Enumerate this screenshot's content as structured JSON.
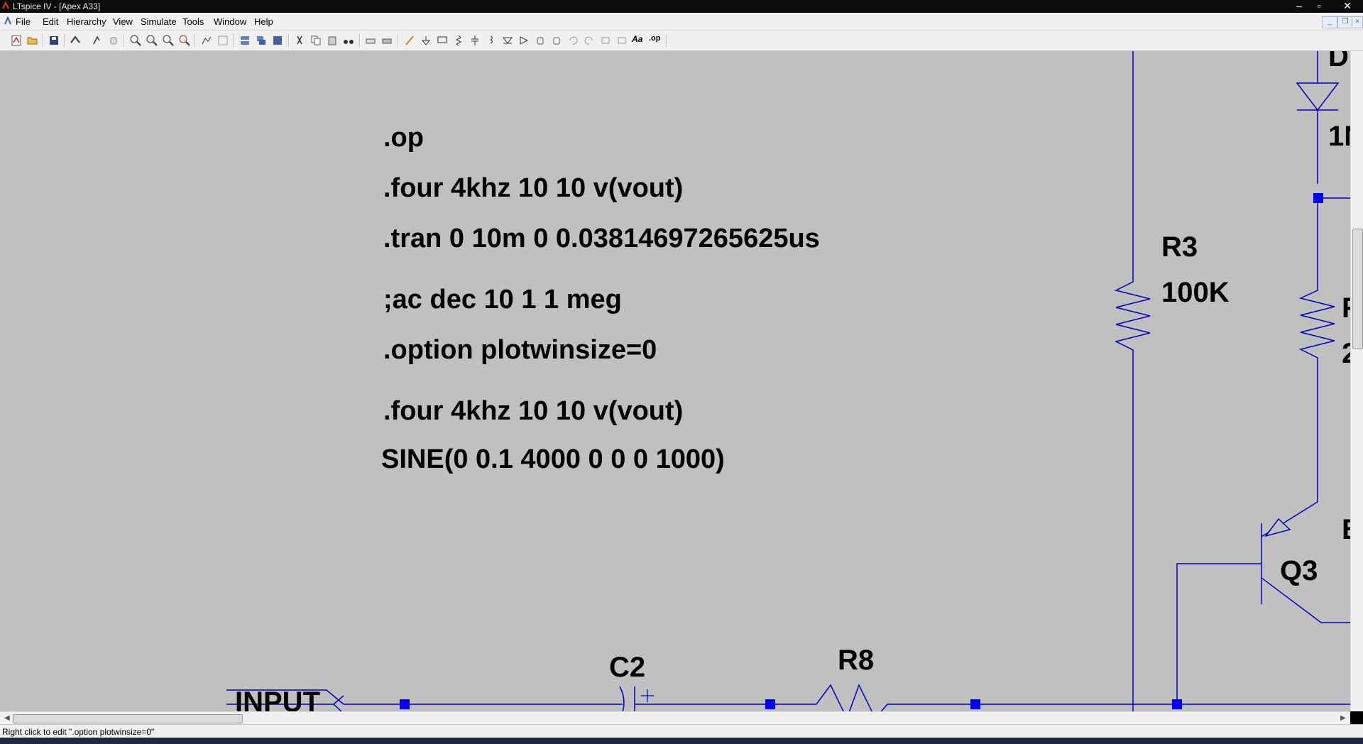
{
  "window": {
    "title": "LTspice IV - [Apex A33]"
  },
  "menu": [
    "File",
    "Edit",
    "Hierarchy",
    "View",
    "Simulate",
    "Tools",
    "Window",
    "Help"
  ],
  "directives": [
    ".op",
    ".four 4khz 10 10 v(vout)",
    ".tran 0 10m 0 0.03814697265625us",
    ";ac dec 10 1 1 meg",
    ".option plotwinsize=0",
    ".four 4khz 10 10 v(vout)",
    "SINE(0 0.1 4000 0 0 0 1000)"
  ],
  "components": {
    "r3_name": "R3",
    "r3_value": "100K",
    "q3_name": "Q3",
    "c2_name": "C2",
    "r8_name": "R8",
    "input_label": "INPUT",
    "d_name_partial": "D",
    "d_value_partial": "1N",
    "r_partial_name": "R",
    "r_partial_value": "2",
    "q_partial": "B"
  },
  "status": {
    "text": "Right click to edit \".option plotwinsize=0\""
  },
  "colors": {
    "canvas": "#c0c0c0",
    "wire": "#0000bb",
    "junction": "#0000ff"
  }
}
